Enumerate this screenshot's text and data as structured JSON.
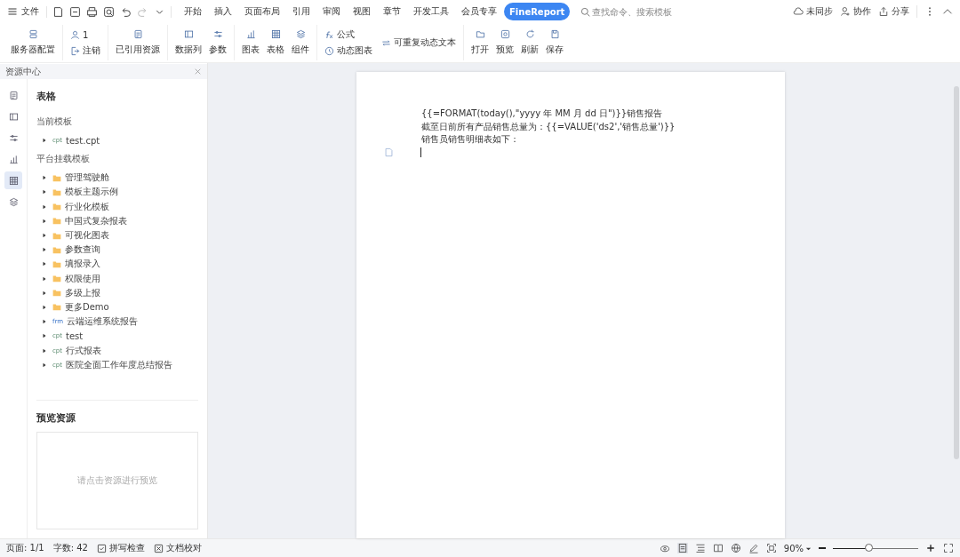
{
  "menu": {
    "label": "文件"
  },
  "tabs": [
    {
      "label": "开始",
      "selected": false
    },
    {
      "label": "插入",
      "selected": false
    },
    {
      "label": "页面布局",
      "selected": false
    },
    {
      "label": "引用",
      "selected": false
    },
    {
      "label": "审阅",
      "selected": false
    },
    {
      "label": "视图",
      "selected": false
    },
    {
      "label": "章节",
      "selected": false
    },
    {
      "label": "开发工具",
      "selected": false
    },
    {
      "label": "会员专享",
      "selected": false
    },
    {
      "label": "FineReport",
      "selected": true
    }
  ],
  "search": {
    "placeholder": "查找命令、搜索模板"
  },
  "top_actions": [
    {
      "label": "未同步"
    },
    {
      "label": "协作"
    },
    {
      "label": "分享"
    }
  ],
  "ribbon": [
    {
      "kind": "big",
      "items": [
        {
          "label": "服务器配置"
        }
      ]
    },
    {
      "kind": "small",
      "items": [
        {
          "label": "1"
        },
        {
          "label": "注销"
        }
      ]
    },
    {
      "kind": "big",
      "items": [
        {
          "label": "已引用资源"
        }
      ]
    },
    {
      "kind": "big",
      "items": [
        {
          "label": "数据列"
        },
        {
          "label": "参数"
        }
      ]
    },
    {
      "kind": "big",
      "items": [
        {
          "label": "图表"
        },
        {
          "label": "表格"
        },
        {
          "label": "组件"
        }
      ]
    },
    {
      "kind": "small",
      "items": [
        {
          "label": "公式"
        },
        {
          "label": "动态图表"
        },
        {
          "label": "可重复动态文本"
        }
      ]
    },
    {
      "kind": "big",
      "items": [
        {
          "label": "打开"
        },
        {
          "label": "预览"
        },
        {
          "label": "刷新"
        },
        {
          "label": "保存"
        }
      ]
    }
  ],
  "panel": {
    "title": "资源中心",
    "rail": [
      {
        "selected": false
      },
      {
        "selected": false
      },
      {
        "selected": false
      },
      {
        "selected": false
      },
      {
        "selected": true
      },
      {
        "selected": false
      }
    ],
    "heading": "表格",
    "sections": [
      {
        "title": "当前模板",
        "items": [
          {
            "kind": "cpt",
            "tag": "cpt",
            "label": "test.cpt"
          }
        ]
      },
      {
        "title": "平台挂载模板",
        "items": [
          {
            "kind": "folder",
            "label": "管理驾驶舱"
          },
          {
            "kind": "folder",
            "label": "模板主题示例"
          },
          {
            "kind": "folder",
            "label": "行业化模板"
          },
          {
            "kind": "folder",
            "label": "中国式复杂报表"
          },
          {
            "kind": "folder",
            "label": "可视化图表"
          },
          {
            "kind": "folder",
            "label": "参数查询"
          },
          {
            "kind": "folder",
            "label": "填报录入"
          },
          {
            "kind": "folder",
            "label": "权限使用"
          },
          {
            "kind": "folder",
            "label": "多级上报"
          },
          {
            "kind": "folder",
            "label": "更多Demo"
          },
          {
            "kind": "frm",
            "tag": "frm",
            "label": "云端运维系统报告"
          },
          {
            "kind": "cpt",
            "tag": "cpt",
            "label": "test"
          },
          {
            "kind": "cpt",
            "tag": "cpt",
            "label": "行式报表"
          },
          {
            "kind": "cpt",
            "tag": "cpt",
            "label": "医院全面工作年度总结报告"
          }
        ]
      }
    ],
    "preview": {
      "title": "预览资源",
      "hint": "请点击资源进行预览"
    }
  },
  "document": {
    "lines": [
      "{{=FORMAT(today(),\"yyyy 年 MM 月 dd 日\")}}销售报告",
      "截至日前所有产品销售总量为：{{=VALUE('ds2','销售总量')}}",
      "销售员销售明细表如下："
    ]
  },
  "status_bar": {
    "page": "页面: 1/1",
    "words": "字数: 42",
    "spell": "拼写检查",
    "proof": "文档校对",
    "zoom": "90%",
    "zoom_slider": {
      "level": 0.43
    }
  }
}
